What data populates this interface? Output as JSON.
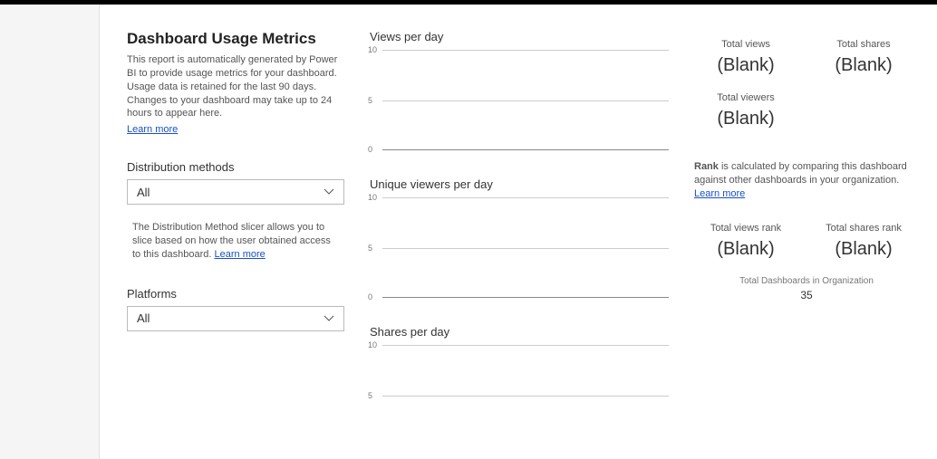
{
  "title": "Dashboard Usage Metrics",
  "description": "This report is automatically generated by Power BI to provide usage metrics for your dashboard. Usage data is retained for the last 90 days. Changes to your dashboard may take up to 24 hours to appear here.",
  "learn_more": "Learn more",
  "distribution": {
    "label": "Distribution methods",
    "value": "All",
    "helper": "The Distribution Method slicer allows you to slice based on how the user obtained access to this dashboard.",
    "helper_link": "Learn more"
  },
  "platforms": {
    "label": "Platforms",
    "value": "All"
  },
  "charts": {
    "views": {
      "title": "Views per day"
    },
    "viewers": {
      "title": "Unique viewers per day"
    },
    "shares": {
      "title": "Shares per day"
    },
    "y_ticks": {
      "top": "10",
      "mid": "5",
      "bot": "0"
    }
  },
  "metrics": {
    "total_views": {
      "label": "Total views",
      "value": "(Blank)"
    },
    "total_shares": {
      "label": "Total shares",
      "value": "(Blank)"
    },
    "total_viewers": {
      "label": "Total viewers",
      "value": "(Blank)"
    }
  },
  "rank": {
    "prefix": "Rank",
    "desc": " is calculated by comparing this dashboard against other dashboards in your organization. ",
    "link": "Learn more",
    "views_rank": {
      "label": "Total views rank",
      "value": "(Blank)"
    },
    "shares_rank": {
      "label": "Total shares rank",
      "value": "(Blank)"
    },
    "total_dash_label": "Total Dashboards in Organization",
    "total_dash_value": "35"
  },
  "chart_data": [
    {
      "type": "line",
      "title": "Views per day",
      "x": [],
      "values": [],
      "ylim": [
        0,
        10
      ],
      "xlabel": "",
      "ylabel": ""
    },
    {
      "type": "line",
      "title": "Unique viewers per day",
      "x": [],
      "values": [],
      "ylim": [
        0,
        10
      ],
      "xlabel": "",
      "ylabel": ""
    },
    {
      "type": "line",
      "title": "Shares per day",
      "x": [],
      "values": [],
      "ylim": [
        0,
        10
      ],
      "xlabel": "",
      "ylabel": ""
    }
  ]
}
